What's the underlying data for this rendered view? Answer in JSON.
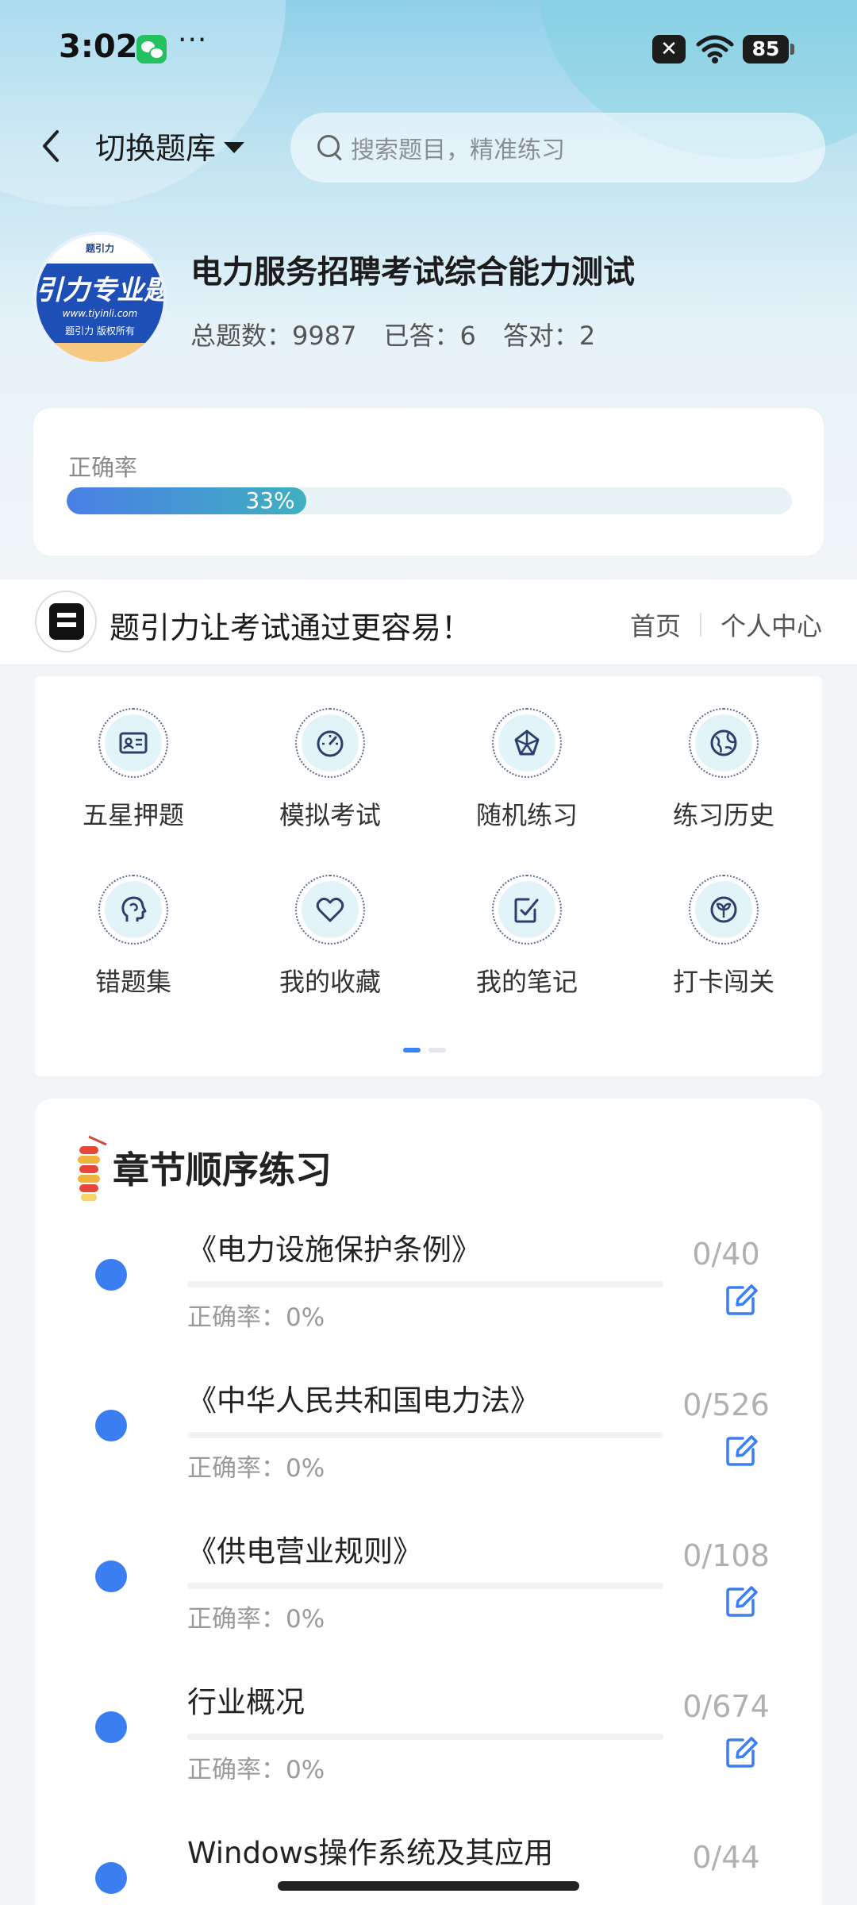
{
  "status_bar": {
    "time": "3:02",
    "battery": "85"
  },
  "header": {
    "switch_label": "切换题库",
    "search_placeholder": "搜索题目，精准练习"
  },
  "bank": {
    "title": "电力服务招聘考试综合能力测试",
    "logo_text": "引力专业题",
    "logo_url": "www.tiyinli.com",
    "logo_footer": "题引力 版权所有",
    "logo_small": "题引力",
    "stats": {
      "total": "总题数：9987",
      "answered": "已答：6",
      "correct": "答对：2"
    }
  },
  "accuracy": {
    "label": "正确率",
    "value_text": "33%",
    "value": 0.33,
    "bar_colors": [
      "#4a7fe6",
      "#3fb0c0"
    ]
  },
  "ad_banner": {
    "text": "题引力让考试通过更容易！",
    "links": [
      "首页",
      "个人中心"
    ]
  },
  "features": [
    {
      "label": "五星押题",
      "icon": "id-card-icon"
    },
    {
      "label": "模拟考试",
      "icon": "speedometer-icon"
    },
    {
      "label": "随机练习",
      "icon": "network-icon"
    },
    {
      "label": "练习历史",
      "icon": "globe-icon"
    },
    {
      "label": "错题集",
      "icon": "head-icon"
    },
    {
      "label": "我的收藏",
      "icon": "heart-icon"
    },
    {
      "label": "我的笔记",
      "icon": "note-check-icon"
    },
    {
      "label": "打卡闯关",
      "icon": "leaf-icon"
    }
  ],
  "chapter_section": {
    "title": "章节顺序练习",
    "items": [
      {
        "name": "《电力设施保护条例》",
        "accuracy": "正确率：0%",
        "count": "0/40"
      },
      {
        "name": "《中华人民共和国电力法》",
        "accuracy": "正确率：0%",
        "count": "0/526"
      },
      {
        "name": "《供电营业规则》",
        "accuracy": "正确率：0%",
        "count": "0/108"
      },
      {
        "name": "行业概况",
        "accuracy": "正确率：0%",
        "count": "0/674"
      },
      {
        "name": "Windows操作系统及其应用",
        "accuracy": "",
        "count": "0/44"
      }
    ]
  },
  "colors": {
    "accent": "#3b7ef2",
    "icon_bg": "#e3f4f9",
    "icon_stroke": "#2c3e6b"
  }
}
